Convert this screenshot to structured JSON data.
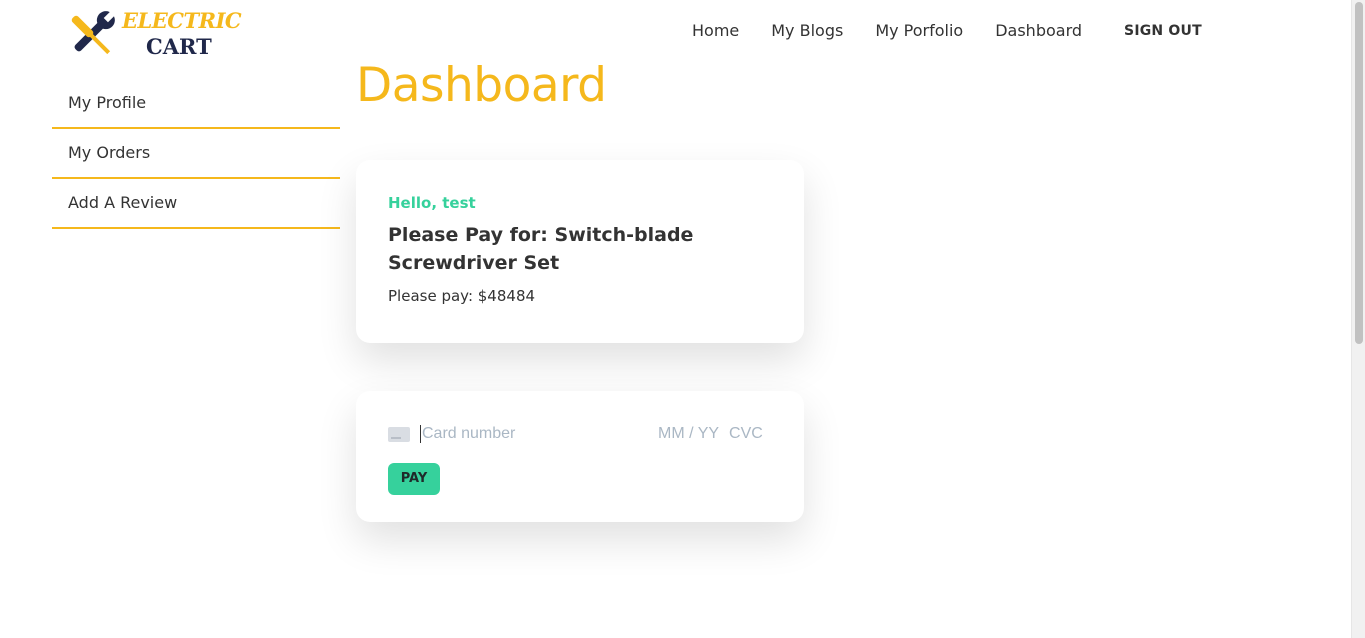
{
  "brand": {
    "line1": "ELECTRIC",
    "line2": "CART",
    "icon": "crossed-tools-icon",
    "colors": {
      "accent": "#f5b81c",
      "dark": "#20284a"
    }
  },
  "nav": {
    "items": [
      {
        "label": "Home"
      },
      {
        "label": "My Blogs"
      },
      {
        "label": "My Porfolio"
      },
      {
        "label": "Dashboard"
      }
    ],
    "signout_label": "SIGN OUT"
  },
  "sidebar": {
    "items": [
      {
        "label": "My Profile"
      },
      {
        "label": "My Orders"
      },
      {
        "label": "Add A Review"
      }
    ]
  },
  "main": {
    "title": "Dashboard",
    "greeting": "Hello, test",
    "pay_for": "Please Pay for: Switch-blade Screwdriver Set",
    "pay_amount": "Please pay: $48484"
  },
  "payment": {
    "card_icon": "credit-card-icon",
    "card_placeholder": "Card number",
    "exp_placeholder": "MM / YY",
    "cvc_placeholder": "CVC",
    "pay_label": "PAY"
  },
  "colors": {
    "accent": "#f5b81c",
    "success": "#36d19c",
    "text": "#333333"
  }
}
